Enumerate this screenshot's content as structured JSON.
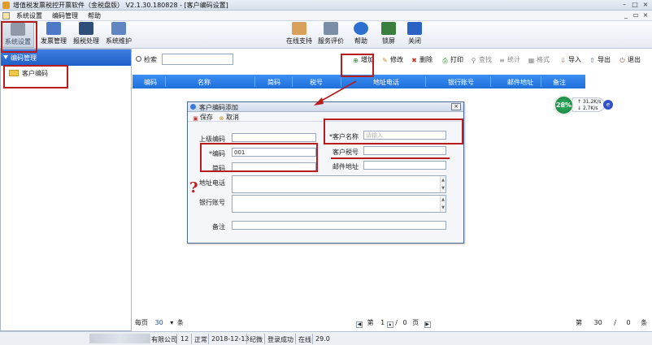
{
  "window": {
    "title": "增值税发票税控开票软件（金税盘版） V2.1.30.180828 - [客户编码设置]",
    "minimize": "–",
    "restore": "□",
    "close": "×"
  },
  "menu": {
    "items": [
      "系统设置",
      "编码管理",
      "帮助"
    ],
    "mdi_min": "_",
    "mdi_restore": "▭",
    "mdi_close": "×"
  },
  "toolbar": {
    "left": [
      {
        "label": "系统设置",
        "icon": "gear-icon",
        "color": "#8f99a7"
      },
      {
        "label": "发票管理",
        "icon": "invoice-icon",
        "color": "#4d79c7"
      },
      {
        "label": "报税处理",
        "icon": "monitor-icon",
        "color": "#2f4f78"
      },
      {
        "label": "系统维护",
        "icon": "maintenance-icon",
        "color": "#5f86c3"
      }
    ],
    "right": [
      {
        "label": "在线支持",
        "icon": "person-icon",
        "color": "#d9a05b"
      },
      {
        "label": "服务评价",
        "icon": "rating-icon",
        "color": "#7a8ea8"
      },
      {
        "label": "帮助",
        "icon": "help-icon",
        "color": "#2d6fd1"
      },
      {
        "label": "锁屏",
        "icon": "lock-screen-icon",
        "color": "#3a7f3d"
      },
      {
        "label": "关闭",
        "icon": "back-arrow-icon",
        "color": "#2b63c4"
      }
    ]
  },
  "sidebar": {
    "header": "编码管理",
    "tree_item": "客户编码"
  },
  "search": {
    "label": "检索",
    "value": ""
  },
  "actions": [
    {
      "label": "增加",
      "glyph": "⊕",
      "color": "#2d8a2d",
      "enabled": true
    },
    {
      "label": "修改",
      "glyph": "✎",
      "color": "#c98d1c",
      "enabled": true
    },
    {
      "label": "删除",
      "glyph": "✖",
      "color": "#c0392b",
      "enabled": true
    },
    {
      "label": "打印",
      "glyph": "⎙",
      "color": "#2d8a2d",
      "enabled": true
    },
    {
      "label": "查找",
      "glyph": "⚲",
      "color": "#8a8a8a",
      "enabled": false
    },
    {
      "label": "统计",
      "glyph": "≡",
      "color": "#8a8a8a",
      "enabled": false
    },
    {
      "label": "格式",
      "glyph": "▦",
      "color": "#8a8a8a",
      "enabled": false
    },
    {
      "label": "导入",
      "glyph": "⇩",
      "color": "#c76a1c",
      "enabled": true
    },
    {
      "label": "导出",
      "glyph": "⇧",
      "color": "#2b63c4",
      "enabled": true
    },
    {
      "label": "退出",
      "glyph": "⏻",
      "color": "#c0392b",
      "enabled": true
    }
  ],
  "grid": {
    "columns": [
      "编码",
      "名称",
      "简码",
      "税号",
      "地址电话",
      "银行账号",
      "邮件地址",
      "备注"
    ]
  },
  "net_badge": {
    "percent": "28%",
    "up": "31.2K/s",
    "down": "2.7K/s"
  },
  "dialog": {
    "title": "客户编码添加",
    "save": "保存",
    "cancel": "取消",
    "fields": {
      "parent_code_label": "上级编码",
      "code_label": "*编码",
      "code_value": "001",
      "short_code_label": "简码",
      "name_label": "*客户名称",
      "name_placeholder": "请输入",
      "tax_id_label": "客户税号",
      "email_label": "邮件地址",
      "address_label": "地址电话",
      "bank_label": "银行账号",
      "remark_label": "备注"
    }
  },
  "annotation": {
    "question_mark": "?"
  },
  "pager": {
    "per_page_label": "每页",
    "per_page_value": "30",
    "per_page_unit": "条",
    "page_prefix": "第",
    "current_page": "1",
    "separator": "/",
    "total_pages": "0",
    "page_suffix": "页",
    "right_prefix": "第",
    "right_value": "30",
    "right_sep": "/",
    "right_total": "0",
    "right_unit": "条"
  },
  "status": {
    "company_suffix": "有限公司",
    "count": "12",
    "state": "正常",
    "date": "2018-12-13",
    "user": "纪微",
    "login": "登录成功",
    "online": "在线",
    "version": "29.0"
  }
}
